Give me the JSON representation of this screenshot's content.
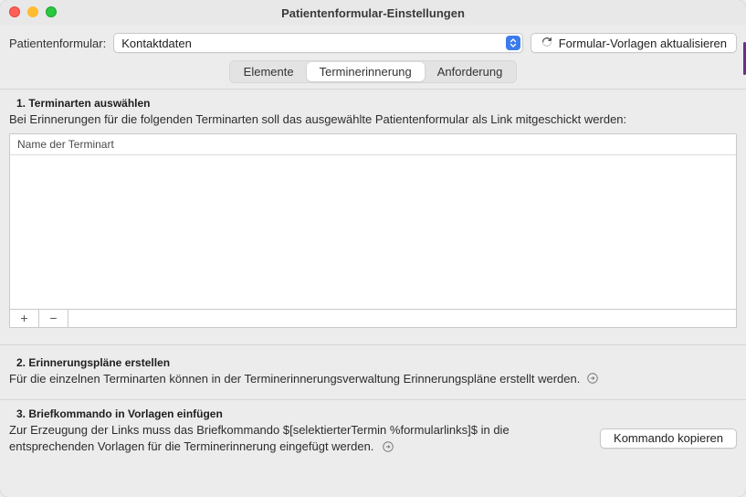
{
  "window": {
    "title": "Patientenformular-Einstellungen"
  },
  "toolbar": {
    "label": "Patientenformular:",
    "select_value": "Kontaktdaten",
    "refresh_label": "Formular-Vorlagen aktualisieren"
  },
  "tabs": {
    "items": [
      "Elemente",
      "Terminerinnerung",
      "Anforderung"
    ],
    "active_index": 1
  },
  "section1": {
    "heading": "1. Terminarten auswählen",
    "description": "Bei Erinnerungen für die folgenden Terminarten soll das ausgewählte Patientenformular als Link mitgeschickt werden:",
    "column_header": "Name der Terminart",
    "rows": [],
    "add_label": "+",
    "remove_label": "−"
  },
  "section2": {
    "heading": "2. Erinnerungspläne erstellen",
    "description": "Für die einzelnen Terminarten können in der Terminerinnerungsverwaltung Erinnerungspläne erstellt werden."
  },
  "section3": {
    "heading": "3. Briefkommando in Vorlagen einfügen",
    "description": "Zur Erzeugung der Links muss das Briefkommando $[selektierterTermin %formularlinks]$ in die entsprechenden Vorlagen für die Terminerinnerung eingefügt werden.",
    "copy_button": "Kommando kopieren"
  }
}
